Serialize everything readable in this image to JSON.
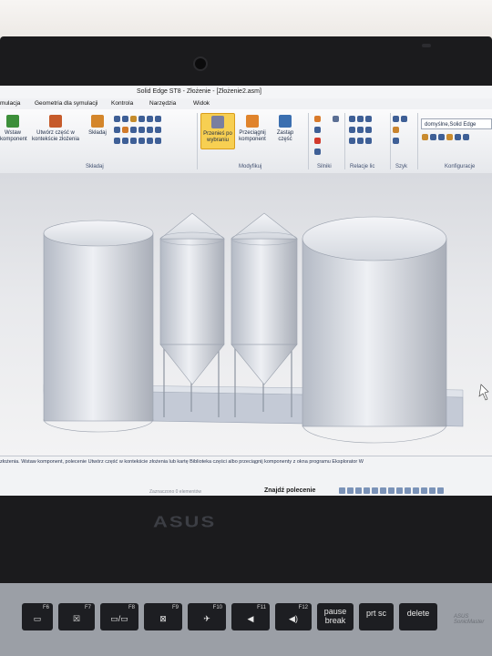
{
  "window": {
    "title": "Solid Edge ST8 - Złożenie - [Złożenie2.asm]"
  },
  "menu": [
    "mulacja",
    "Geometria dla symulacji",
    "Kontrola",
    "Narzędzia",
    "Widok"
  ],
  "ribbon": {
    "insert_component": "Wstaw\nkomponent",
    "create_part_in_context": "Utwórz część w\nkontekście złożenia",
    "assemble": "Składaj",
    "move_selected": "Przenieś po\nwybraniu",
    "drag_component": "Przeciągnij\nkomponent",
    "replace_part": "Zastąp\nczęść",
    "config_value": "domyślne,Solid Edge",
    "groups": {
      "assemble": "Składaj",
      "modify": "Modyfikuj",
      "motors": "Silniki",
      "relations": "Relacje lic",
      "pattern": "Szyk",
      "configurations": "Konfiguracje"
    }
  },
  "status": {
    "message": "złożenia. Wstaw komponent, polecenie Utwórz część w kontekście złożenia lub kartę Biblioteka części albo przeciągnij komponenty z okna programu Eksplorator W",
    "selected": "Zaznaczono 0 elementów",
    "find_command": "Znajdź polecenie"
  },
  "laptop": {
    "brand": "ASUS",
    "sticker": "ASUS SonicMaster"
  },
  "keyboard": [
    {
      "fn": "F6",
      "glyph": "▭"
    },
    {
      "fn": "F7",
      "glyph": "☒"
    },
    {
      "fn": "F8",
      "glyph": "▭/▭"
    },
    {
      "fn": "F9",
      "glyph": "⊠"
    },
    {
      "fn": "F10",
      "glyph": "✈"
    },
    {
      "fn": "F11",
      "glyph": "◀"
    },
    {
      "fn": "F12",
      "glyph": "◀)"
    },
    {
      "fn": "",
      "glyph": "pause\nbreak"
    },
    {
      "fn": "",
      "glyph": "prt sc"
    },
    {
      "fn": "",
      "glyph": "delete"
    }
  ],
  "colors": {
    "highlight": "#f7cf52",
    "bezel": "#1b1b1d",
    "ribbon_text": "#1c2a44"
  }
}
